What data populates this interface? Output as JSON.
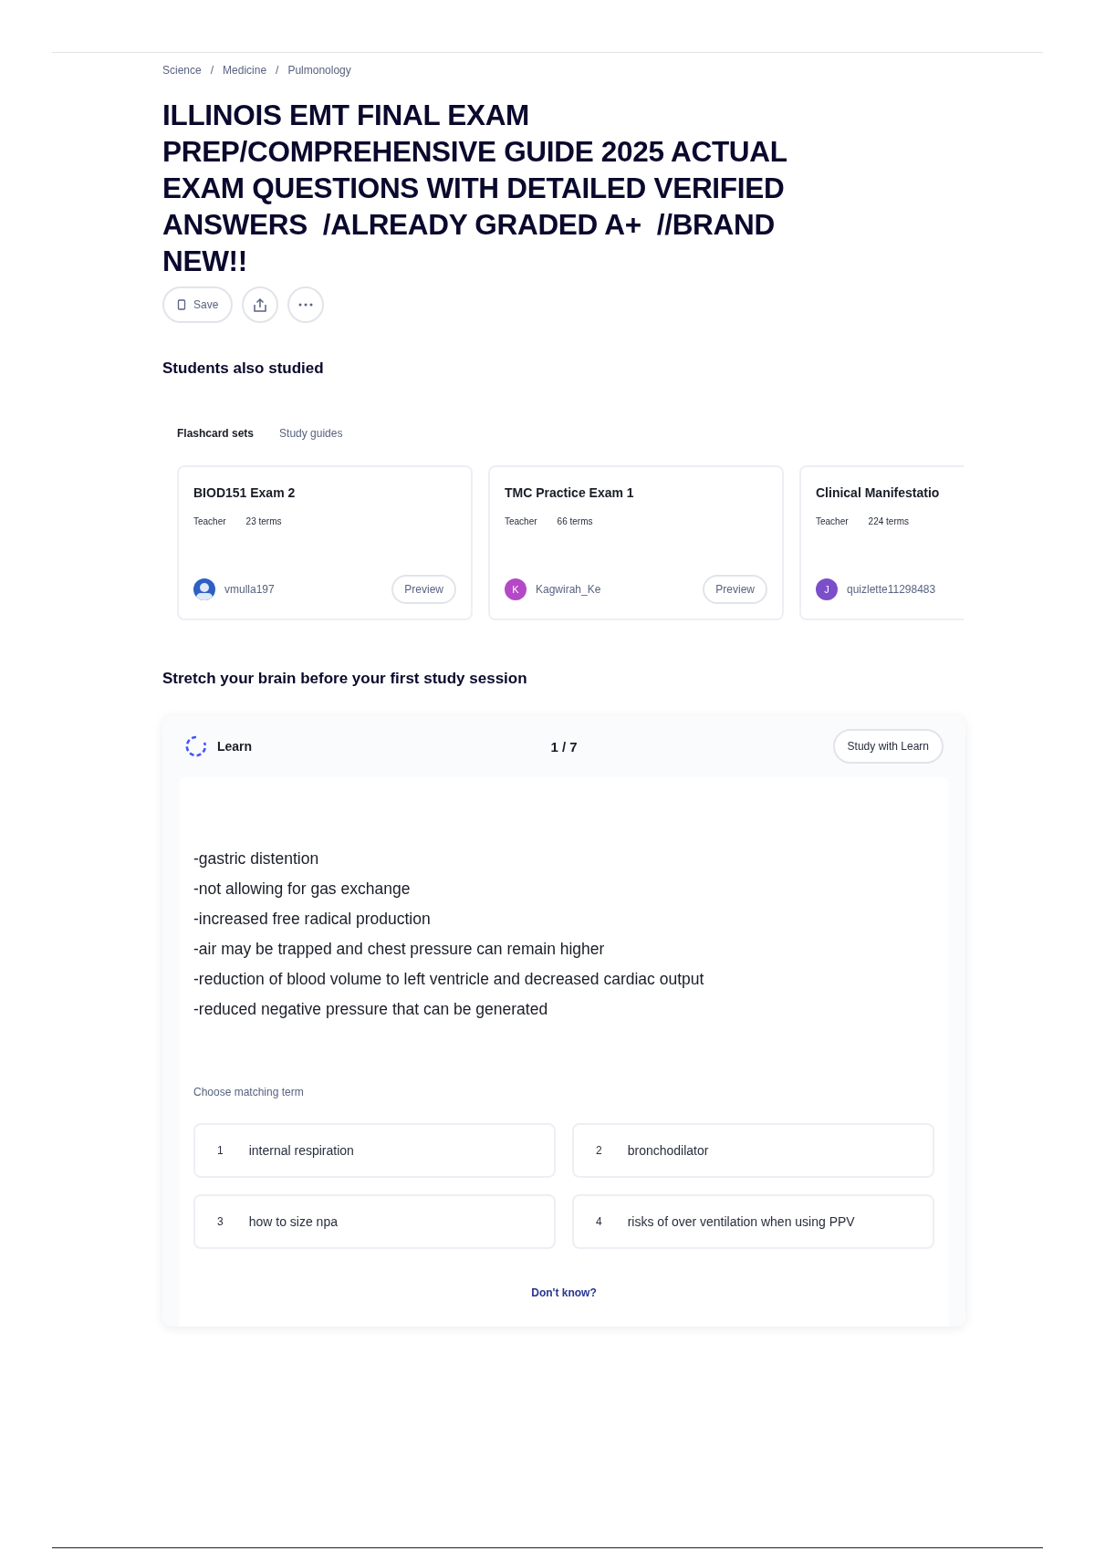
{
  "breadcrumb": [
    {
      "label": "Science",
      "separator": "/"
    },
    {
      "label": "Medicine",
      "separator": "/"
    },
    {
      "label": "Pulmonology"
    }
  ],
  "title": "ILLINOIS EMT FINAL EXAM PREP/COMPREHENSIVE GUIDE 2025 ACTUAL EXAM QUESTIONS WITH DETAILED VERIFIED ANSWERS  /ALREADY GRADED A+  //BRAND NEW!!",
  "actions": {
    "save": "Save"
  },
  "also_studied": {
    "heading": "Students also studied",
    "tabs": [
      {
        "label": "Flashcard sets",
        "selected": true
      },
      {
        "label": "Study guides",
        "selected": false
      }
    ],
    "cards": [
      {
        "title": "BIOD151 Exam 2",
        "role": "Teacher",
        "terms": "23 terms",
        "author": "vmulla197",
        "preview": "Preview"
      },
      {
        "title": "TMC Practice Exam 1",
        "role": "Teacher",
        "terms": "66 terms",
        "author": "Kagwirah_Ke",
        "avatar": {
          "kind": "letter",
          "letter": "K",
          "color": "#b548c6"
        },
        "preview": "Preview"
      },
      {
        "title": "Clinical Manifestatio",
        "role": "Teacher",
        "terms": "224 terms",
        "author": "quizlette11298483",
        "avatar": {
          "kind": "letter",
          "letter": "J",
          "color": "#7b4fc9"
        }
      }
    ]
  },
  "learn": {
    "heading": "Stretch your brain before your first study session",
    "mode": "Learn",
    "progress": "1 / 7",
    "study_button": "Study with Learn",
    "definition": [
      "-gastric distention",
      "-not allowing for gas exchange",
      "-increased free radical production",
      "-air may be trapped and chest pressure can remain higher",
      "-reduction of blood volume to left ventricle and decreased cardiac output",
      "-reduced negative pressure that can be generated"
    ],
    "prompt": "Choose matching term",
    "options": [
      {
        "number": "1",
        "text": "internal respiration"
      },
      {
        "number": "2",
        "text": "bronchodilator"
      },
      {
        "number": "3",
        "text": "how to size npa"
      },
      {
        "number": "4",
        "text": "risks of over ventilation when using PPV"
      }
    ],
    "dont_know": "Don't know?"
  }
}
